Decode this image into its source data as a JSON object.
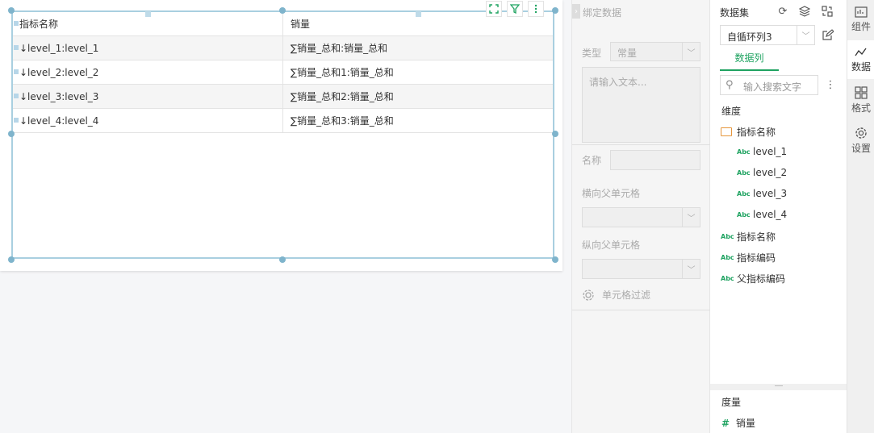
{
  "table": {
    "header": [
      "指标名称",
      "销量"
    ],
    "rows": [
      [
        "↓level_1:level_1",
        "∑销量_总和:销量_总和"
      ],
      [
        "↓level_2:level_2",
        "∑销量_总和1:销量_总和"
      ],
      [
        "↓level_3:level_3",
        "∑销量_总和2:销量_总和"
      ],
      [
        "↓level_4:level_4",
        "∑销量_总和3:销量_总和"
      ]
    ]
  },
  "bind_panel": {
    "title": "绑定数据",
    "type_label": "类型",
    "type_value": "常量",
    "text_placeholder": "请输入文本...",
    "name_label": "名称",
    "h_parent_label": "横向父单元格",
    "v_parent_label": "纵向父单元格",
    "cell_filter_label": "单元格过滤"
  },
  "dataset_panel": {
    "title": "数据集",
    "dataset_value": "自循环列3",
    "tab_label": "数据列",
    "search_placeholder": "输入搜索文字",
    "dimension_label": "维度",
    "folder_label": "指标名称",
    "folder_children": [
      "level_1",
      "level_2",
      "level_3",
      "level_4"
    ],
    "fields": [
      "指标名称",
      "指标编码",
      "父指标编码"
    ],
    "measure_label": "度量",
    "measures": [
      "销量"
    ]
  },
  "side_tabs": [
    "组件",
    "数据",
    "格式",
    "设置"
  ],
  "colors": {
    "accent": "#1fa361",
    "selection": "#a9cfe0",
    "folder": "#e6963c"
  }
}
